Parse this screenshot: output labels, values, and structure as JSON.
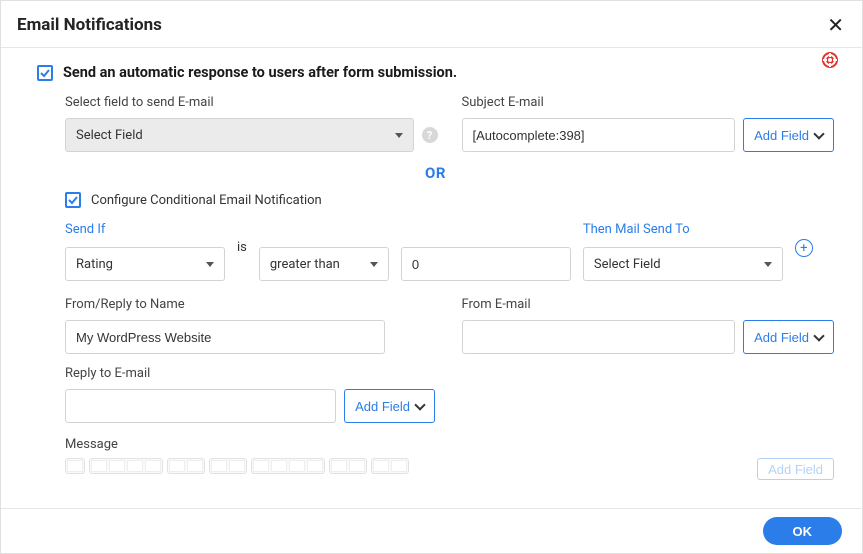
{
  "header": {
    "title": "Email Notifications"
  },
  "enable": {
    "checked": true,
    "label": "Send an automatic response to users after form submission."
  },
  "select_field": {
    "label": "Select field to send E-mail",
    "value": "Select Field"
  },
  "subject": {
    "label": "Subject E-mail",
    "value": "[Autocomplete:398]",
    "add_field": "Add Field"
  },
  "or_divider": "OR",
  "conditional": {
    "checked": true,
    "label": "Configure Conditional Email Notification",
    "send_if_label": "Send If",
    "field_value": "Rating",
    "is_label": "is",
    "op_value": "greater than",
    "val_value": "0",
    "then_label": "Then Mail Send To",
    "then_value": "Select Field"
  },
  "from_name": {
    "label": "From/Reply to Name",
    "value": "My WordPress Website"
  },
  "from_email": {
    "label": "From E-mail",
    "value": "",
    "add_field": "Add Field"
  },
  "reply_email": {
    "label": "Reply to E-mail",
    "value": "",
    "add_field": "Add Field"
  },
  "message": {
    "label": "Message",
    "add_field": "Add Field"
  },
  "footer": {
    "ok": "OK"
  }
}
